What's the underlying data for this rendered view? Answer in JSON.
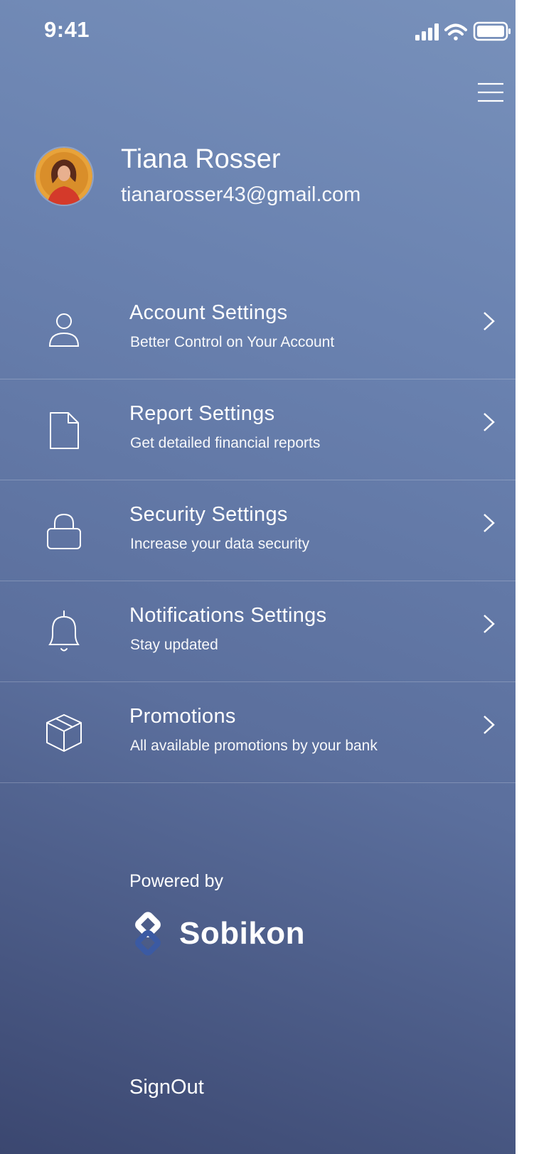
{
  "status_bar": {
    "time": "9:41",
    "icons": [
      "signal-icon",
      "wifi-icon",
      "battery-icon"
    ]
  },
  "header": {
    "menu_icon": "hamburger-menu-icon"
  },
  "profile": {
    "name": "Tiana Rosser",
    "email": "tianarosser43@gmail.com"
  },
  "menu": {
    "items": [
      {
        "icon": "user-icon",
        "title": "Account Settings",
        "subtitle": "Better Control on Your Account"
      },
      {
        "icon": "document-icon",
        "title": "Report Settings",
        "subtitle": "Get detailed financial reports"
      },
      {
        "icon": "lock-icon",
        "title": "Security Settings",
        "subtitle": "Increase your data security"
      },
      {
        "icon": "bell-icon",
        "title": "Notifications Settings",
        "subtitle": "Stay updated"
      },
      {
        "icon": "box-icon",
        "title": "Promotions",
        "subtitle": "All available promotions by your bank"
      }
    ]
  },
  "footer": {
    "powered_by": "Powered by",
    "brand": "Sobikon",
    "signout": "SignOut"
  },
  "colors": {
    "gradient_top": "#7891bb",
    "gradient_bottom": "#3b4770",
    "text": "#ffffff",
    "logo_accent": "#3b5aa3"
  }
}
